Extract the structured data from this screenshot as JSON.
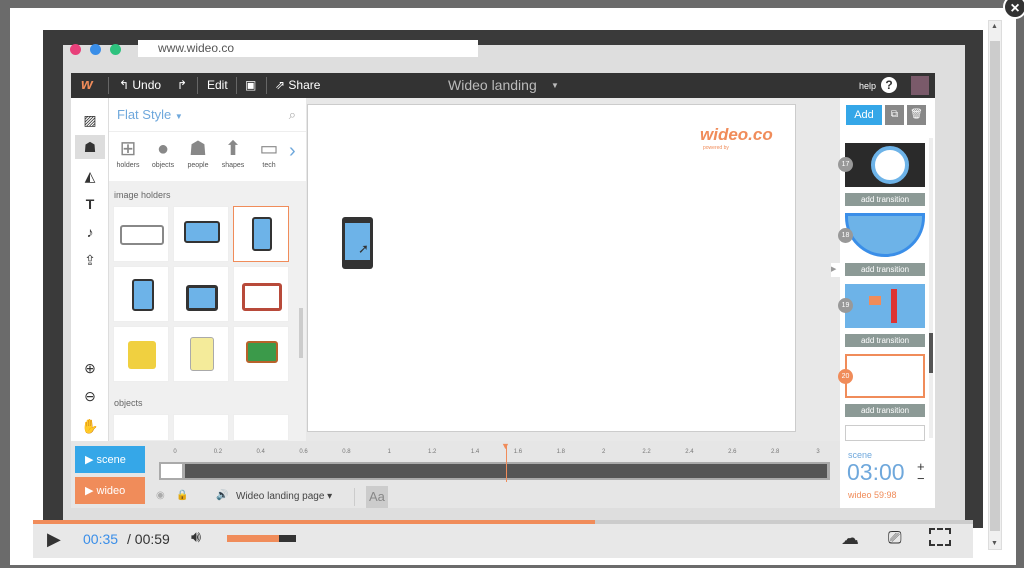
{
  "browser": {
    "url": "www.wideo.co"
  },
  "toolbar": {
    "undo": "Undo",
    "edit": "Edit",
    "share": "Share",
    "title": "Wideo landing",
    "help": "help"
  },
  "library": {
    "style": "Flat Style",
    "categories": [
      "holders",
      "objects",
      "people",
      "shapes",
      "tech"
    ],
    "section_image_holders": "image holders",
    "section_objects": "objects"
  },
  "canvas": {
    "logo": "wideo.co",
    "logo_sub": "powered by"
  },
  "scenes": {
    "add": "Add",
    "items": [
      {
        "num": "17"
      },
      {
        "num": "18"
      },
      {
        "num": "19"
      },
      {
        "num": "20"
      }
    ],
    "transition": "add transition"
  },
  "timeline": {
    "scene_btn": "scene",
    "wideo_btn": "wideo",
    "ticks": [
      "0",
      "0.2",
      "0.4",
      "0.6",
      "0.8",
      "1",
      "1.2",
      "1.4",
      "1.6",
      "1.8",
      "2",
      "2.2",
      "2.4",
      "2.6",
      "2.8",
      "3"
    ],
    "layer": "Wideo landing page",
    "text_tool": "Aa"
  },
  "timer": {
    "label": "scene",
    "time": "03:00",
    "total": "wideo 59:98",
    "plus": "+",
    "minus": "−"
  },
  "player": {
    "current": "00:35",
    "duration": "/ 00:59",
    "progress_percent": 59.8,
    "volume_percent": 75
  },
  "colors": {
    "accent": "#f08c5a",
    "blue": "#35a7e8"
  }
}
